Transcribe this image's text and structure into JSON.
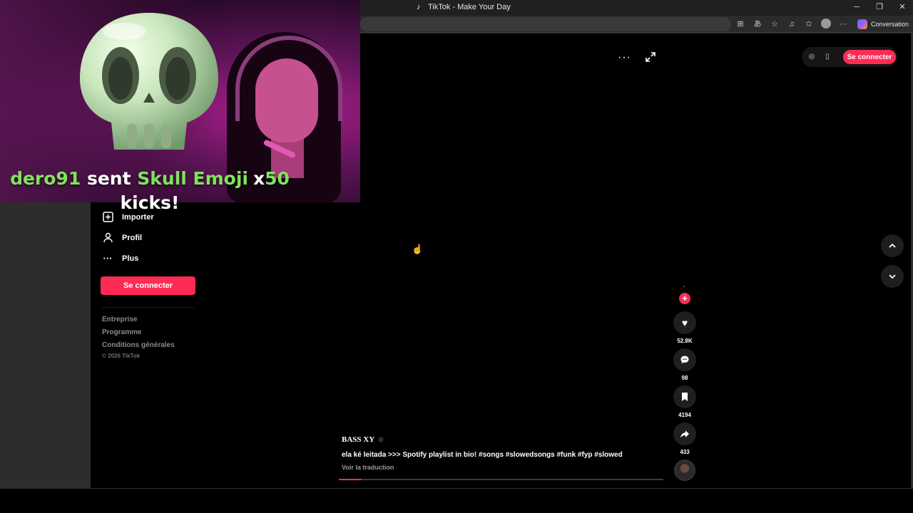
{
  "browser": {
    "tab_title": "TikTok - Make Your Day",
    "address_value": "",
    "toolbar": {
      "more": "···",
      "copilot_label": "Conversation"
    },
    "window": {
      "minimize": "─",
      "restore": "❐",
      "close": "✕"
    }
  },
  "sidebar": {
    "items": [
      {
        "label": "Importer",
        "icon": "plus-square-icon"
      },
      {
        "label": "Profil",
        "icon": "person-icon"
      },
      {
        "label": "Plus",
        "icon": "more-dots-icon",
        "glyph": "···"
      }
    ],
    "login_button": "Se connecter",
    "footer_links": [
      "Entreprise",
      "Programme",
      "Conditions générales"
    ],
    "copyright": "© 2026 TikTok"
  },
  "topbar": {
    "more": "···",
    "login_button": "Se connecter"
  },
  "navigation": {
    "up": "⌃",
    "down": "⌄"
  },
  "video": {
    "author": "BASS XY",
    "author_badge": "⚛",
    "caption": "ela ké leitada  >>> Spotify playlist in bio! #songs #slowedsongs #funk #fyp #slowed",
    "translate_link": "Voir la traduction",
    "progress_percent": 7,
    "likes": "52.8K",
    "comments": "98",
    "saves": "4194",
    "shares": "433"
  },
  "overlay": {
    "sender": "dero91",
    "verb": "sent",
    "gift_name": "Skull Emoji",
    "multiplier_prefix": "x",
    "count": "50",
    "suffix": "kicks!"
  },
  "colors": {
    "accent": "#fe2c55",
    "gift_highlight": "#7ee35d"
  }
}
